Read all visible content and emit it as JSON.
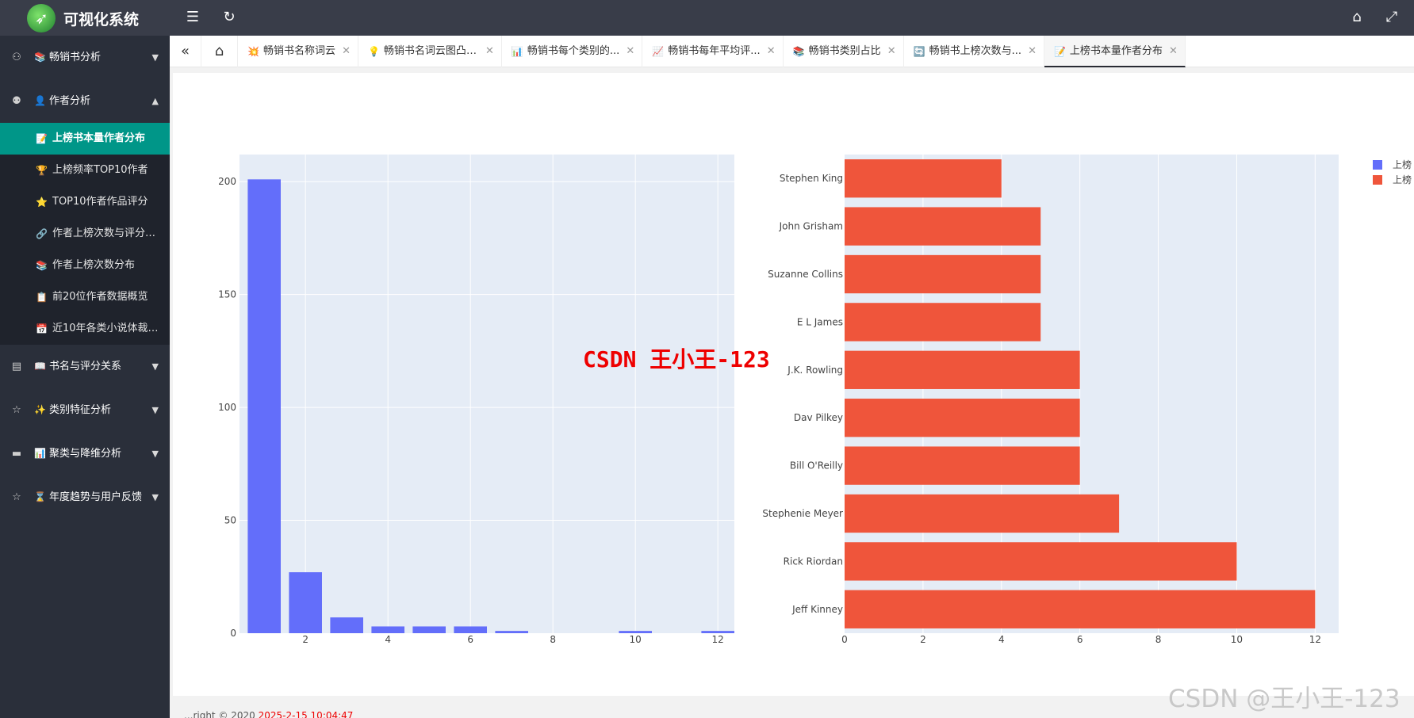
{
  "header": {
    "title": "可视化系统",
    "icons": [
      "menu-fold-icon",
      "refresh-icon",
      "tag-icon",
      "fullscreen-icon"
    ]
  },
  "sidebar": {
    "groups": [
      {
        "emoji": "📚",
        "label": "畅销书分析",
        "expanded": false
      },
      {
        "emoji": "👤",
        "label": "作者分析",
        "expanded": true,
        "items": [
          {
            "emoji": "📝",
            "label": "上榜书本量作者分布",
            "active": true
          },
          {
            "emoji": "🏆",
            "label": "上榜频率TOP10作者"
          },
          {
            "emoji": "⭐",
            "label": "TOP10作者作品评分"
          },
          {
            "emoji": "🔗",
            "label": "作者上榜次数与评分关系"
          },
          {
            "emoji": "📚",
            "label": "作者上榜次数分布"
          },
          {
            "emoji": "📋",
            "label": "前20位作者数据概览"
          },
          {
            "emoji": "📅",
            "label": "近10年各类小说体裁分析"
          }
        ]
      },
      {
        "emoji": "📖",
        "label": "书名与评分关系",
        "expanded": false
      },
      {
        "emoji": "✨",
        "label": "类别特征分析",
        "expanded": false
      },
      {
        "emoji": "📊",
        "label": "聚类与降维分析",
        "expanded": false
      },
      {
        "emoji": "⌛",
        "label": "年度趋势与用户反馈",
        "expanded": false
      }
    ]
  },
  "tabs": [
    {
      "emoji": "💥",
      "label": "畅销书名称词云"
    },
    {
      "emoji": "💡",
      "label": "畅销书名词云图凸出..."
    },
    {
      "emoji": "📊",
      "label": "畅销书每个类别的..."
    },
    {
      "emoji": "📈",
      "label": "畅销书每年平均评..."
    },
    {
      "emoji": "📚",
      "label": "畅销书类别占比"
    },
    {
      "emoji": "🔄",
      "label": "畅销书上榜次数与..."
    },
    {
      "emoji": "📝",
      "label": "上榜书本量作者分布",
      "active": true
    }
  ],
  "chart_data": [
    {
      "type": "bar",
      "x": [
        1,
        2,
        3,
        4,
        5,
        6,
        7,
        10,
        12
      ],
      "values": [
        201,
        27,
        7,
        3,
        3,
        3,
        1,
        1,
        1
      ],
      "xticks": [
        2,
        4,
        6,
        8,
        10,
        12
      ],
      "yticks": [
        0,
        50,
        100,
        150,
        200
      ],
      "xlim": [
        0.4,
        12.4
      ],
      "ylim": [
        0,
        212
      ],
      "color": "#636efa",
      "legend_label": "上榜",
      "grid": true
    },
    {
      "type": "bar",
      "orientation": "horizontal",
      "categories": [
        "Stephen King",
        "John Grisham",
        "Suzanne Collins",
        "E L James",
        "J.K. Rowling",
        "Dav Pilkey",
        "Bill O'Reilly",
        "Stephenie Meyer",
        "Rick Riordan",
        "Jeff Kinney"
      ],
      "values": [
        4,
        5,
        5,
        5,
        6,
        6,
        6,
        7,
        10,
        12
      ],
      "xticks": [
        0,
        2,
        4,
        6,
        8,
        10,
        12
      ],
      "xlim": [
        0,
        12.6
      ],
      "color": "#ef553b",
      "legend_label": "上榜",
      "grid": true
    }
  ],
  "watermark": {
    "center": "CSDN 王小王-123",
    "corner": "CSDN @王小王-123"
  },
  "footer": {
    "text": "...right © 2020 ",
    "timestamp": "2025-2-15 10:04:47"
  }
}
